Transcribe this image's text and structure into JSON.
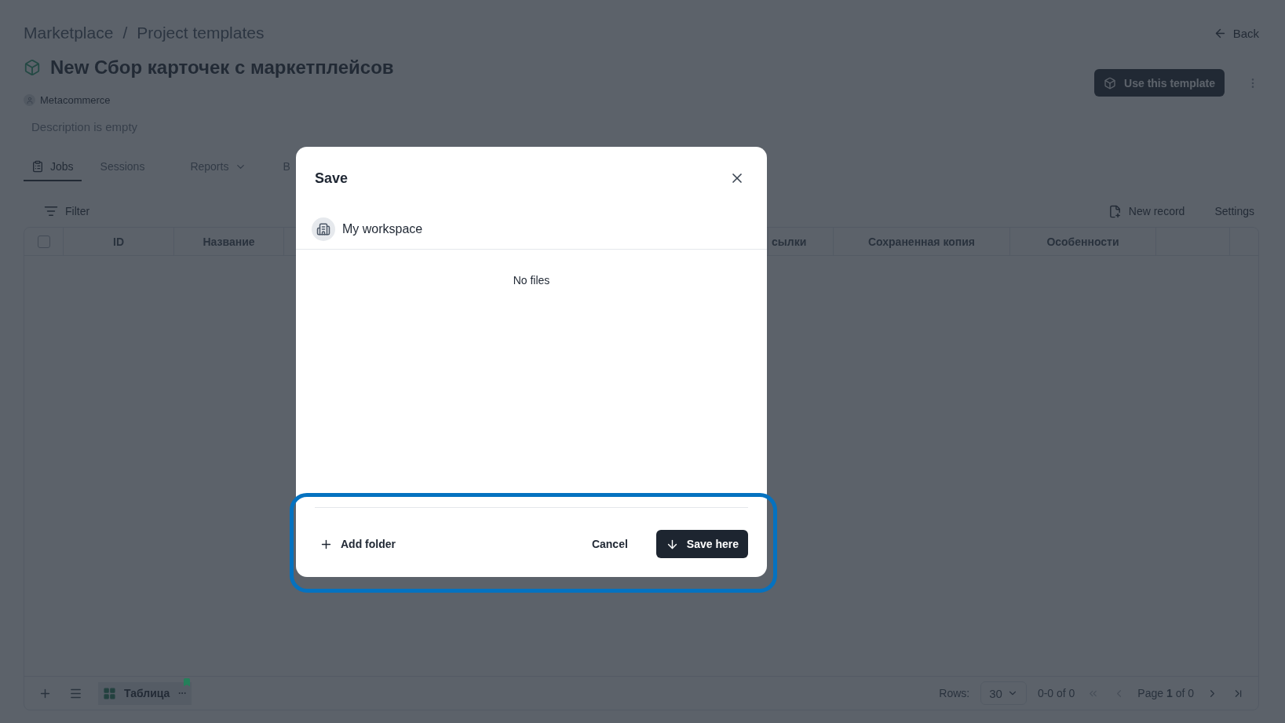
{
  "breadcrumb": [
    "Marketplace",
    "Project templates"
  ],
  "breadcrumb_separator": "/",
  "back": "Back",
  "project": {
    "title": "New Сбор карточек с маркетплейсов",
    "owner": "Metacommerce",
    "description": "Description is empty"
  },
  "primary_action": "Use this template",
  "tabs": [
    {
      "label": "Jobs",
      "kind": "icon",
      "selected": true
    },
    {
      "label": "Sessions",
      "kind": "plain",
      "selected": false
    },
    {
      "label": "Reports",
      "kind": "dropdown",
      "selected": false
    },
    {
      "label": "B",
      "kind": "plain",
      "selected": false
    }
  ],
  "toolbar": {
    "filter": "Filter",
    "actions": [
      {
        "label": "New record",
        "kind": "icon"
      },
      {
        "label": "Settings",
        "kind": "plain"
      }
    ]
  },
  "table": {
    "select_all": {
      "checked": false
    },
    "columns": [
      "ID",
      "Название",
      "сылки",
      "Сохраненная копия",
      "Особенности"
    ]
  },
  "footer": {
    "views": [
      {
        "label": "Таблица",
        "selected": true,
        "color": "#24805a"
      }
    ],
    "rows_label": "Rows:",
    "rows_value": "30",
    "range": "0-0 of 0",
    "page": "Page **1** of 0"
  },
  "dialog": {
    "title": "Save",
    "location": "My workspace",
    "empty": "No files",
    "add": "Add folder",
    "cancel": "Cancel",
    "confirm": "Save here",
    "footer_highlighted": true
  }
}
